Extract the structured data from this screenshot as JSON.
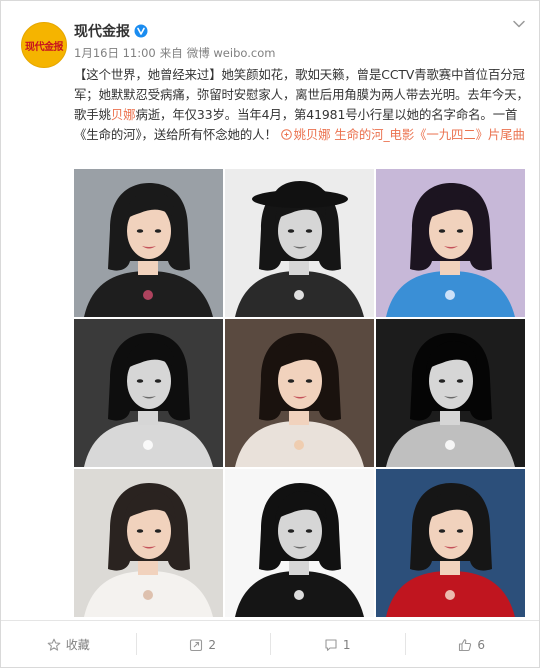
{
  "account": {
    "avatar_text": "现代金报",
    "name": "现代金报"
  },
  "meta": {
    "date": "1月16日 11:00",
    "source_prefix": "来自",
    "source": "微博 weibo.com"
  },
  "post": {
    "text_1": "【这个世界，她曾经来过】她笑颜如花，歌如天籁，曾是CCTV青歌赛中首位百分冠军；她默默忍受病痛，弥留时安慰家人，离世后用角膜为两人带去光明。去年今天，歌手姚",
    "text_hl": "贝娜",
    "text_2": "病逝，年仅33岁。当年4月，第41981号小行星以她的名字命名。一首《生命的河》，送给所有怀念她的人！",
    "link": "姚贝娜 生命的河_电影《一九四二》片尾曲"
  },
  "photos": [
    {
      "tone": "color-dark",
      "bg": "#9aa0a6",
      "hair": "#1a1a1a",
      "outfit": "#1e1e1e",
      "accent": "#c84a6a"
    },
    {
      "tone": "bw-hat",
      "bg": "#ececec",
      "hair": "#151515",
      "outfit": "#2a2a2a",
      "accent": "#ffffff"
    },
    {
      "tone": "color-blue",
      "bg": "#c7b8d8",
      "hair": "#1c1420",
      "outfit": "#3a8fd6",
      "accent": "#e6f0ff"
    },
    {
      "tone": "bw",
      "bg": "#3a3a3a",
      "hair": "#0e0e0e",
      "outfit": "#d8d8d8",
      "accent": "#ffffff"
    },
    {
      "tone": "color-warm",
      "bg": "#5a4a40",
      "hair": "#1a120e",
      "outfit": "#e9e1da",
      "accent": "#f0c9a8"
    },
    {
      "tone": "bw-dark",
      "bg": "#1c1c1c",
      "hair": "#050505",
      "outfit": "#bfbfbf",
      "accent": "#ffffff"
    },
    {
      "tone": "color-light",
      "bg": "#dcdad6",
      "hair": "#2a2320",
      "outfit": "#f4f2ef",
      "accent": "#d9b8a2"
    },
    {
      "tone": "bw-sketch",
      "bg": "#f7f7f7",
      "hair": "#111111",
      "outfit": "#151515",
      "accent": "#ffffff"
    },
    {
      "tone": "color-red",
      "bg": "#2c4f7a",
      "hair": "#161616",
      "outfit": "#c0151f",
      "accent": "#f3d7c8"
    }
  ],
  "footer": {
    "favorite": "收藏",
    "repost": "2",
    "comment": "1",
    "like": "6"
  }
}
